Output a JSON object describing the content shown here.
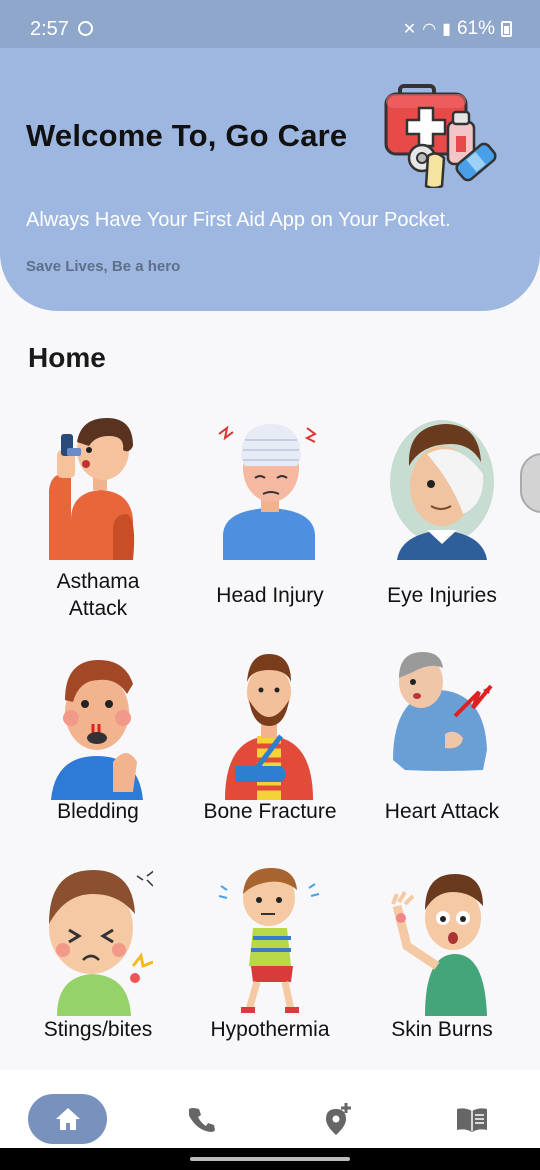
{
  "status_bar": {
    "time": "2:57",
    "battery": "61%"
  },
  "header": {
    "title": "Welcome To, Go Care",
    "subtitle": "Always Have Your First Aid App on Your Pocket.",
    "tagline": "Save Lives, Be a hero"
  },
  "section_title": "Home",
  "categories": [
    {
      "label": "Asthama\nAttack",
      "icon": "asthma-inhaler-icon"
    },
    {
      "label": "Head Injury",
      "icon": "head-bandage-icon"
    },
    {
      "label": "Eye Injuries",
      "icon": "eye-bandage-icon"
    },
    {
      "label": "Bledding",
      "icon": "nosebleed-icon"
    },
    {
      "label": "Bone Fracture",
      "icon": "arm-sling-icon"
    },
    {
      "label": "Heart Attack",
      "icon": "chest-pain-icon"
    },
    {
      "label": "Stings/bites",
      "icon": "mosquito-bite-icon"
    },
    {
      "label": "Hypothermia",
      "icon": "shivering-child-icon"
    },
    {
      "label": "Skin Burns",
      "icon": "burned-hand-icon"
    }
  ],
  "bottom_nav": [
    {
      "name": "home",
      "icon": "home-icon",
      "active": true
    },
    {
      "name": "call",
      "icon": "phone-icon",
      "active": false
    },
    {
      "name": "location",
      "icon": "add-location-icon",
      "active": false
    },
    {
      "name": "guide",
      "icon": "book-icon",
      "active": false
    }
  ],
  "colors": {
    "header": "#9db7e0",
    "active_nav": "#7892bd",
    "background": "#f8f7f9"
  }
}
